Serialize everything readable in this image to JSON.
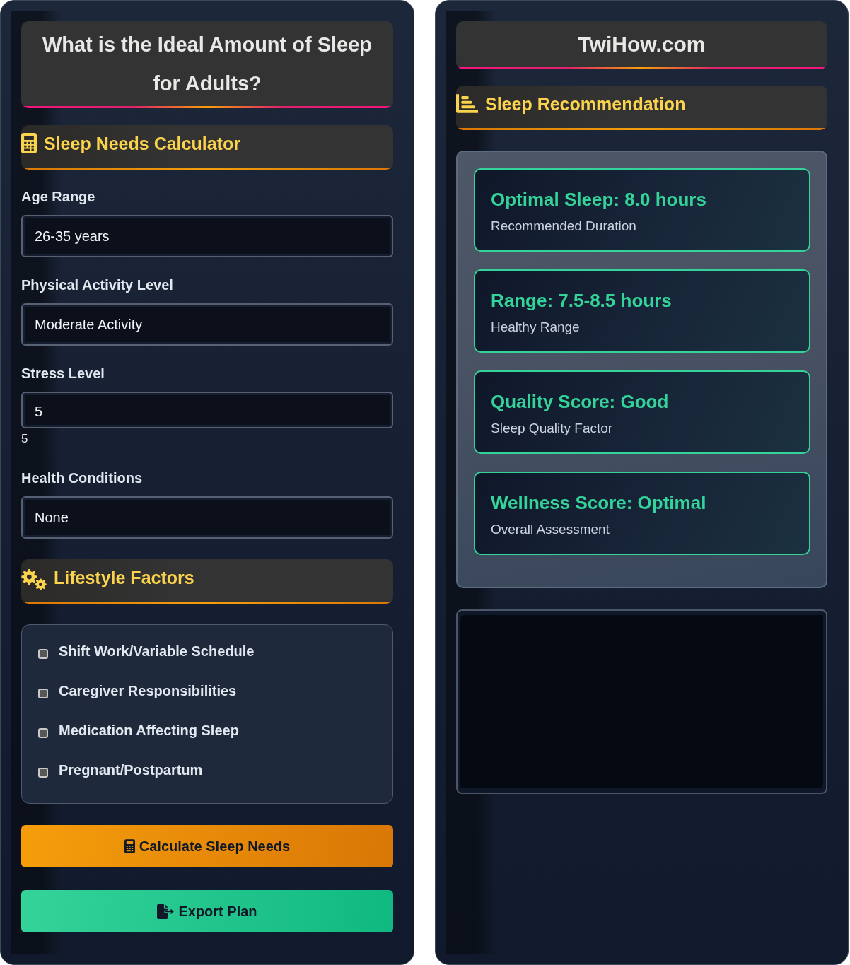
{
  "calculator_panel": {
    "title": "What is the Ideal Amount of Sleep for Adults?",
    "section_heading": "Sleep Needs Calculator",
    "fields": [
      {
        "kind": "select",
        "label": "Age Range",
        "value": "26-35 years"
      },
      {
        "kind": "select",
        "label": "Physical Activity Level",
        "value": "Moderate Activity"
      },
      {
        "kind": "input",
        "label": "Stress Level",
        "value": "5",
        "reading": "5"
      },
      {
        "kind": "select",
        "label": "Health Conditions",
        "value": "None"
      }
    ],
    "lifestyle": {
      "heading": "Lifestyle Factors",
      "options": [
        {
          "label": "Shift Work/Variable Schedule",
          "checked": false
        },
        {
          "label": "Caregiver Responsibilities",
          "checked": false
        },
        {
          "label": "Medication Affecting Sleep",
          "checked": false
        },
        {
          "label": "Pregnant/Postpartum",
          "checked": false
        }
      ]
    },
    "buttons": [
      {
        "kind": "calculate",
        "label": "Calculate Sleep Needs"
      },
      {
        "kind": "export",
        "label": "Export Plan"
      }
    ]
  },
  "results_panel": {
    "site": "TwiHow.com",
    "heading": "Sleep Recommendation",
    "results": [
      {
        "value": "Optimal Sleep: 8.0 hours",
        "caption": "Recommended Duration"
      },
      {
        "value": "Range: 7.5-8.5 hours",
        "caption": "Healthy Range"
      },
      {
        "value": "Quality Score: Good",
        "caption": "Sleep Quality Factor"
      },
      {
        "value": "Wellness Score: Optimal",
        "caption": "Overall Assessment"
      }
    ]
  }
}
